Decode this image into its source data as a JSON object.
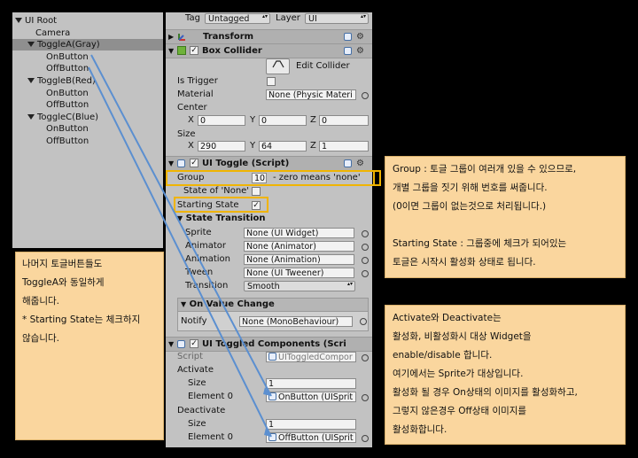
{
  "hierarchy": {
    "items": [
      {
        "label": "UI Root",
        "indent": 0,
        "expanded": true,
        "selected": false
      },
      {
        "label": "Camera",
        "indent": 1,
        "expanded": false,
        "selected": false
      },
      {
        "label": "ToggleA(Gray)",
        "indent": 1,
        "expanded": true,
        "selected": true
      },
      {
        "label": "OnButton",
        "indent": 2,
        "expanded": false,
        "selected": false
      },
      {
        "label": "OffButton",
        "indent": 2,
        "expanded": false,
        "selected": false
      },
      {
        "label": "ToggleB(Red)",
        "indent": 1,
        "expanded": true,
        "selected": false
      },
      {
        "label": "OnButton",
        "indent": 2,
        "expanded": false,
        "selected": false
      },
      {
        "label": "OffButton",
        "indent": 2,
        "expanded": false,
        "selected": false
      },
      {
        "label": "ToggleC(Blue)",
        "indent": 1,
        "expanded": true,
        "selected": false
      },
      {
        "label": "OnButton",
        "indent": 2,
        "expanded": false,
        "selected": false
      },
      {
        "label": "OffButton",
        "indent": 2,
        "expanded": false,
        "selected": false
      }
    ]
  },
  "inspector": {
    "tag_label": "Tag",
    "tag_value": "Untagged",
    "layer_label": "Layer",
    "layer_value": "UI",
    "transform": {
      "title": "Transform"
    },
    "box_collider": {
      "title": "Box Collider",
      "edit_collider": "Edit Collider",
      "is_trigger_label": "Is Trigger",
      "material_label": "Material",
      "material_value": "None (Physic Materi",
      "center_label": "Center",
      "center": {
        "x_label": "X",
        "x": "0",
        "y_label": "Y",
        "y": "0",
        "z_label": "Z",
        "z": "0"
      },
      "size_label": "Size",
      "size": {
        "x_label": "X",
        "x": "290",
        "y_label": "Y",
        "y": "64",
        "z_label": "Z",
        "z": "1"
      }
    },
    "ui_toggle": {
      "title": "UI Toggle (Script)",
      "group_label": "Group",
      "group_value": "10",
      "group_hint": "- zero means 'none'",
      "state_of_none_label": "State of 'None'",
      "starting_state_label": "Starting State",
      "starting_state_checked": true,
      "state_transition_label": "State Transition",
      "sprite_label": "Sprite",
      "sprite_value": "None (UI Widget)",
      "animator_label": "Animator",
      "animator_value": "None (Animator)",
      "animation_label": "Animation",
      "animation_value": "None (Animation)",
      "tween_label": "Tween",
      "tween_value": "None (UI Tweener)",
      "transition_label": "Transition",
      "transition_value": "Smooth",
      "on_value_change_label": "On Value Change",
      "notify_label": "Notify",
      "notify_value": "None (MonoBehaviour)"
    },
    "toggled_components": {
      "title": "UI Toggled Components (Scri",
      "script_label": "Script",
      "script_value": "UIToggledCompor",
      "activate_label": "Activate",
      "activate_size_label": "Size",
      "activate_size": "1",
      "activate_element_label": "Element 0",
      "activate_element": "OnButton (UISprit",
      "deactivate_label": "Deactivate",
      "deactivate_size_label": "Size",
      "deactivate_size": "1",
      "deactivate_element_label": "Element 0",
      "deactivate_element": "OffButton (UISprit"
    }
  },
  "notes": {
    "left": [
      "나머지 토글버튼들도",
      "ToggleA와 동일하게",
      "해줍니다.",
      "* Starting State는 체크하지",
      "않습니다."
    ],
    "group": [
      "Group : 토글 그룹이 여러개 있을 수 있으므로,",
      "개별 그룹을 짓기 위해 번호를 써줍니다.",
      "(0이면 그룹이 없는것으로 처리됩니다.)",
      "",
      "Starting State : 그룹중에 체크가 되어있는",
      "토글은 시작시 활성화 상태로 됩니다."
    ],
    "activate": [
      "Activate와 Deactivate는",
      "활성화, 비활성화시 대상 Widget을",
      "enable/disable 합니다.",
      "여기에서는 Sprite가 대상입니다.",
      "활성화 될 경우 On상태의 이미지를 활성화하고,",
      "그렇지 않은경우 Off상태 이미지를",
      "활성화합니다."
    ]
  },
  "colors": {
    "note_bg": "#fad69e",
    "highlight": "#f0b400",
    "arrow": "#5b8fd0",
    "panel": "#c2c2c2"
  }
}
